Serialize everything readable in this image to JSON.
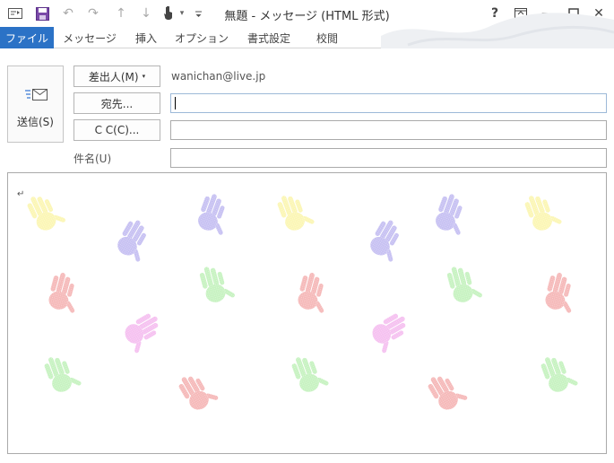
{
  "window": {
    "title": "無題 - メッセージ (HTML 形式)",
    "help": "?",
    "minimize": "—",
    "close": "✕"
  },
  "quick_access": {
    "undo": "↶",
    "redo": "↷",
    "up": "↑",
    "down": "↓",
    "more": "▾"
  },
  "ribbon": {
    "tabs": [
      "ファイル",
      "メッセージ",
      "挿入",
      "オプション",
      "書式設定",
      "校閲"
    ]
  },
  "header": {
    "send_label": "送信(S)",
    "from_button": "差出人(M)",
    "from_caret": "▾",
    "from_value": "wanichan@live.jp",
    "to_button": "宛先...",
    "cc_button": "C C(C)...",
    "subject_label": "件名(U)",
    "to_value": "",
    "cc_value": "",
    "subject_value": ""
  },
  "body": {
    "return_mark": "↵",
    "background": "handprint pattern",
    "colors": {
      "yellow": "#fbf6b4",
      "purple": "#c6c0f2",
      "green": "#c6f2c0",
      "pink": "#f5b8b8",
      "magenta": "#f5c0f0"
    }
  },
  "accent": "#2b72c6"
}
